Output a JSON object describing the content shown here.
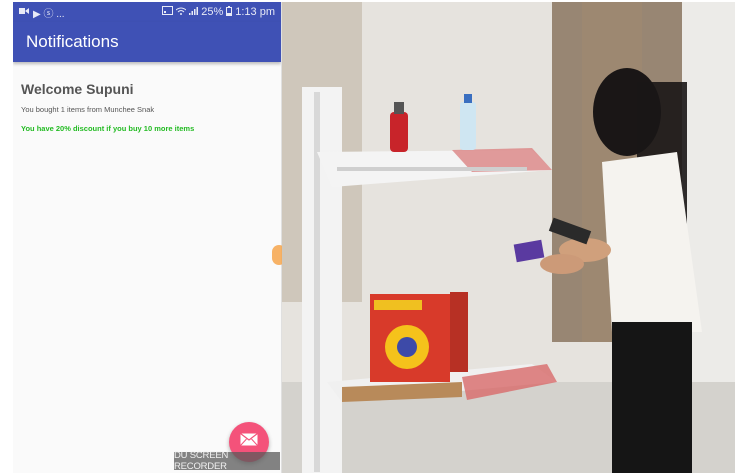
{
  "status_bar": {
    "left_indicators": "▶ ⓢ ...",
    "battery": "25%",
    "time": "1:13 pm"
  },
  "app_bar": {
    "title": "Notifications"
  },
  "notification": {
    "heading": "Welcome Supuni",
    "message": "You bought 1 items from Munchee Snak",
    "discount": "You have 20% discount if you buy 10 more items"
  },
  "fab": {
    "icon": "mail-icon"
  },
  "overlay": {
    "recorder_label": "DU SCREEN RECORDER"
  },
  "video": {
    "description_colors": {
      "wall": "#e9e7e3",
      "shelf": "#f1f1f1",
      "shelf_edge": "#d86a6a",
      "box": "#d83a2a"
    }
  },
  "colors": {
    "primary": "#3f51b5",
    "accent": "#f4527a",
    "discount_text": "#22bb22"
  }
}
